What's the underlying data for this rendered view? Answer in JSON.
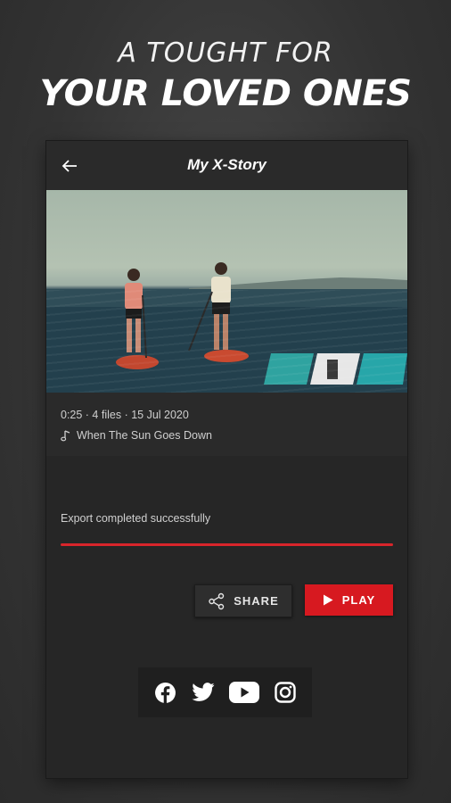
{
  "promo": {
    "line1": "A TOUGHT FOR",
    "line2": "YOUR LOVED ONES"
  },
  "appbar": {
    "title": "My X-Story",
    "back_icon": "arrow-left-icon"
  },
  "story": {
    "meta": "0:25 · 4 files · 15 Jul 2020",
    "song": "When The Sun Goes Down",
    "song_icon": "music-note-icon"
  },
  "export": {
    "status": "Export completed successfully",
    "progress": 1.0
  },
  "actions": {
    "share_label": "SHARE",
    "play_label": "PLAY"
  },
  "social": [
    "facebook-icon",
    "twitter-icon",
    "youtube-icon",
    "instagram-icon"
  ],
  "colors": {
    "accent": "#d71920",
    "background": "#333333",
    "panel": "#262626"
  }
}
